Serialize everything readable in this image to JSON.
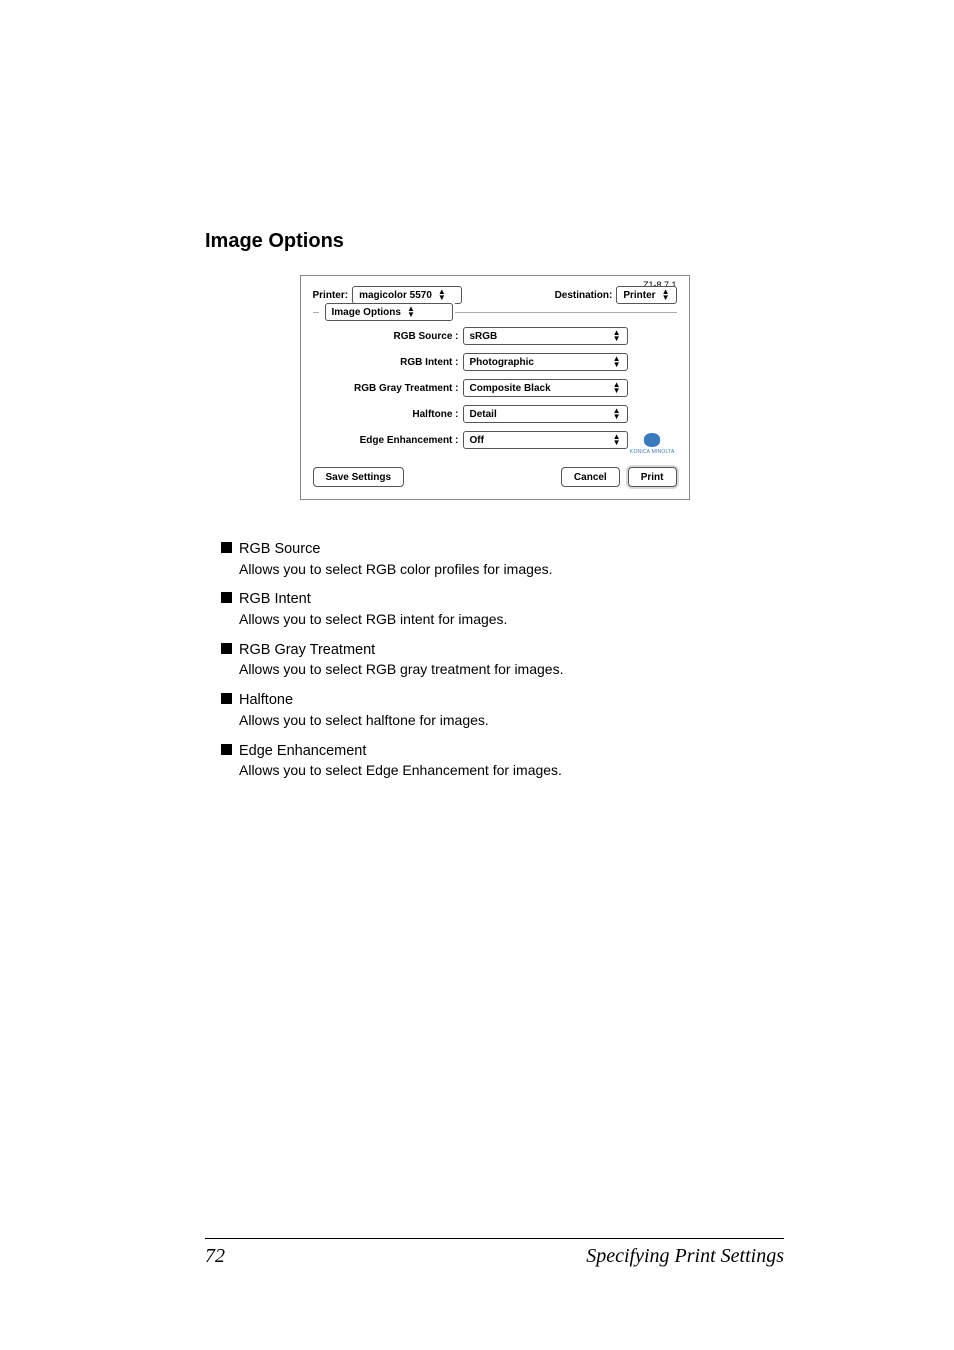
{
  "section_title": "Image Options",
  "dialog": {
    "version": "Z1-8.7.1",
    "printer_label": "Printer:",
    "printer_value": "magicolor 5570",
    "destination_label": "Destination:",
    "destination_value": "Printer",
    "tab_value": "Image Options",
    "rows": {
      "rgb_source": {
        "label": "RGB Source :",
        "value": "sRGB"
      },
      "rgb_intent": {
        "label": "RGB Intent :",
        "value": "Photographic"
      },
      "rgb_gray": {
        "label": "RGB Gray Treatment :",
        "value": "Composite Black"
      },
      "halftone": {
        "label": "Halftone :",
        "value": "Detail"
      },
      "edge_enh": {
        "label": "Edge Enhancement :",
        "value": "Off"
      }
    },
    "brand": "KONICA MINOLTA",
    "buttons": {
      "save": "Save Settings",
      "cancel": "Cancel",
      "print": "Print"
    }
  },
  "descriptions": [
    {
      "title": "RGB Source",
      "text": "Allows you to select RGB color profiles for images."
    },
    {
      "title": "RGB Intent",
      "text": "Allows you to select RGB intent for images."
    },
    {
      "title": "RGB Gray Treatment",
      "text": "Allows you to select RGB gray treatment for images."
    },
    {
      "title": "Halftone",
      "text": "Allows you to select halftone for images."
    },
    {
      "title": "Edge Enhancement",
      "text": "Allows you to select Edge Enhancement for images."
    }
  ],
  "footer": {
    "page_number": "72",
    "running_head": "Specifying Print Settings"
  }
}
